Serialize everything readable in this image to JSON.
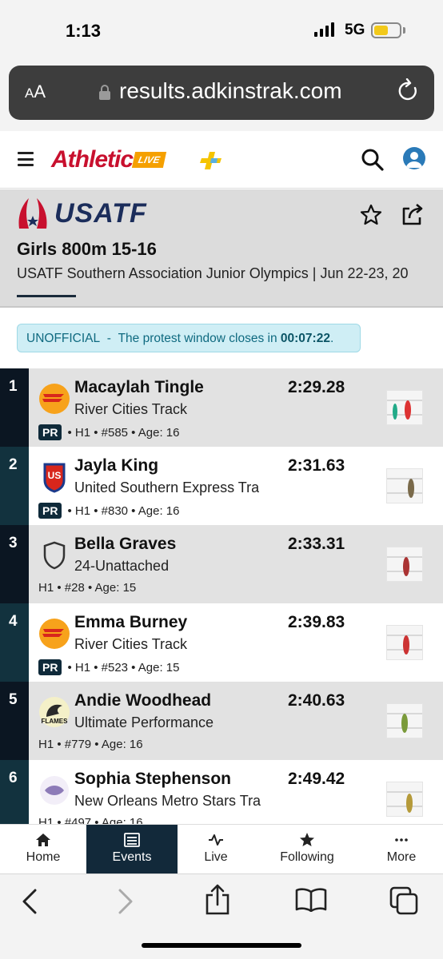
{
  "status_bar": {
    "time": "1:13",
    "network": "5G"
  },
  "browser": {
    "text_size_label": "AA",
    "url": "results.adkinstrak.com"
  },
  "app": {
    "logo_text": "Athletic",
    "logo_badge": "LIVE"
  },
  "event": {
    "org_logo_text": "USATF",
    "title": "Girls 800m 15-16",
    "meet": "USATF Southern Association Junior Olympics | Jun 22-23, 20"
  },
  "banner": {
    "status": "UNOFFICIAL",
    "separator": "-",
    "message": "The protest window closes in",
    "countdown": "00:07:22",
    "end": "."
  },
  "results": [
    {
      "place": "1",
      "name": "Macaylah Tingle",
      "mark": "2:29.28",
      "club": "River Cities Track",
      "pr": "PR",
      "meta": "• H1 • #585 • Age: 16"
    },
    {
      "place": "2",
      "name": "Jayla King",
      "mark": "2:31.63",
      "club": "United Southern Express Tra",
      "pr": "PR",
      "meta": "• H1 • #830 • Age: 16"
    },
    {
      "place": "3",
      "name": "Bella Graves",
      "mark": "2:33.31",
      "club": "24-Unattached",
      "pr": "",
      "meta": "H1 • #28 • Age: 15"
    },
    {
      "place": "4",
      "name": "Emma Burney",
      "mark": "2:39.83",
      "club": "River Cities Track",
      "pr": "PR",
      "meta": "• H1 • #523 • Age: 15"
    },
    {
      "place": "5",
      "name": "Andie Woodhead",
      "mark": "2:40.63",
      "club": "Ultimate Performance",
      "pr": "",
      "meta": "H1 • #779 • Age: 16"
    },
    {
      "place": "6",
      "name": "Sophia Stephenson",
      "mark": "2:49.42",
      "club": "New Orleans Metro Stars Tra",
      "pr": "",
      "meta": "H1 • #497 • Age: 16"
    }
  ],
  "tabs": [
    {
      "label": "Home"
    },
    {
      "label": "Events"
    },
    {
      "label": "Live"
    },
    {
      "label": "Following"
    },
    {
      "label": "More"
    }
  ],
  "colors": {
    "place_dark": "#0b1622",
    "place_teal": "#12323e",
    "row_alt": "#e2e2e2",
    "accent": "#c8102e",
    "banner_bg": "#cfeef5"
  }
}
